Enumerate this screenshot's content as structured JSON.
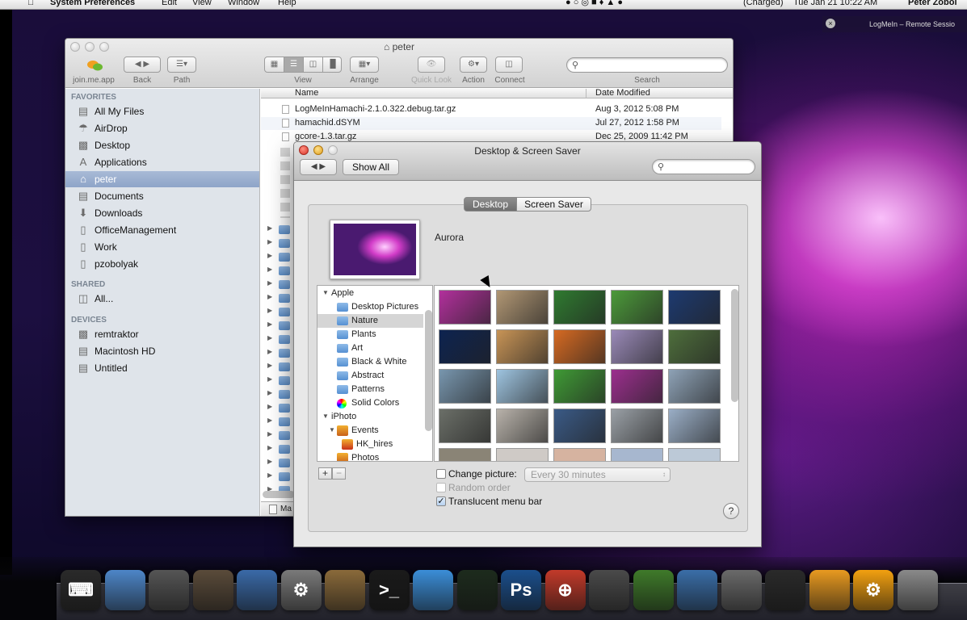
{
  "menubar": {
    "apple": "",
    "app_name": "System Preferences",
    "menus": [
      "Edit",
      "View",
      "Window",
      "Help"
    ],
    "battery_status": "(Charged)",
    "clock": "Tue Jan 21  10:22 AM",
    "user": "Peter Zobol"
  },
  "logmein": {
    "label": "LogMeIn – Remote Sessio"
  },
  "finder": {
    "title": "peter",
    "toolbar": {
      "joinme_label": "join.me.app",
      "back_label": "Back",
      "path_label": "Path",
      "view_label": "View",
      "arrange_label": "Arrange",
      "quicklook_label": "Quick Look",
      "action_label": "Action",
      "connect_label": "Connect",
      "search_label": "Search"
    },
    "sidebar": {
      "favorites_heading": "FAVORITES",
      "favorites": [
        {
          "label": "All My Files",
          "icon": "all-files-icon"
        },
        {
          "label": "AirDrop",
          "icon": "airdrop-icon"
        },
        {
          "label": "Desktop",
          "icon": "desktop-icon"
        },
        {
          "label": "Applications",
          "icon": "applications-icon"
        },
        {
          "label": "peter",
          "icon": "home-icon"
        },
        {
          "label": "Documents",
          "icon": "documents-icon"
        },
        {
          "label": "Downloads",
          "icon": "downloads-icon"
        },
        {
          "label": "OfficeManagement",
          "icon": "folder-icon"
        },
        {
          "label": "Work",
          "icon": "folder-icon"
        },
        {
          "label": "pzobolyak",
          "icon": "folder-icon"
        }
      ],
      "shared_heading": "SHARED",
      "shared": [
        {
          "label": "All...",
          "icon": "network-icon"
        }
      ],
      "devices_heading": "DEVICES",
      "devices": [
        {
          "label": "remtraktor",
          "icon": "computer-icon"
        },
        {
          "label": "Macintosh HD",
          "icon": "hard-drive-icon"
        },
        {
          "label": "Untitled",
          "icon": "disk-icon"
        }
      ]
    },
    "columns": {
      "name": "Name",
      "date_modified": "Date Modified"
    },
    "files": [
      {
        "name": "LogMeInHamachi-2.1.0.322.debug.tar.gz",
        "date": "Aug 3, 2012 5:08 PM"
      },
      {
        "name": "hamachid.dSYM",
        "date": "Jul 27, 2012 1:58 PM"
      },
      {
        "name": "gcore-1.3.tar.gz",
        "date": "Dec 25, 2009 11:42 PM"
      }
    ],
    "status_path": "Ma"
  },
  "prefs": {
    "title": "Desktop & Screen Saver",
    "show_all_label": "Show All",
    "tabs": {
      "desktop": "Desktop",
      "screen_saver": "Screen Saver"
    },
    "current_picture": "Aurora",
    "sources": {
      "apple": "Apple",
      "desktop_pictures": "Desktop Pictures",
      "nature": "Nature",
      "plants": "Plants",
      "art": "Art",
      "black_white": "Black & White",
      "abstract": "Abstract",
      "patterns": "Patterns",
      "solid_colors": "Solid Colors",
      "iphoto": "iPhoto",
      "events": "Events",
      "hk_hires": "HK_hires",
      "photos": "Photos"
    },
    "add_label": "+",
    "remove_label": "−",
    "change_picture_label": "Change picture:",
    "interval_value": "Every 30 minutes",
    "random_order_label": "Random order",
    "translucent_label": "Translucent menu bar",
    "help_label": "?",
    "thumbnails": [
      {
        "name": "aurora",
        "color": "#b2309c"
      },
      {
        "name": "mountains",
        "color": "#b19774"
      },
      {
        "name": "ladybugs",
        "color": "#2f7a30"
      },
      {
        "name": "dew-leaf",
        "color": "#4c9a3a"
      },
      {
        "name": "earth-horizon",
        "color": "#1d3a70"
      },
      {
        "name": "earth-globe",
        "color": "#0d2350"
      },
      {
        "name": "lake-sunset",
        "color": "#c89456"
      },
      {
        "name": "sand-dunes",
        "color": "#d66a22"
      },
      {
        "name": "foggy-waves",
        "color": "#9a8ab8"
      },
      {
        "name": "forest-cliff",
        "color": "#4e6e3c"
      },
      {
        "name": "ocean-horizon",
        "color": "#7896ae"
      },
      {
        "name": "ice-crystals",
        "color": "#9ec4e0"
      },
      {
        "name": "ladybug-leaf",
        "color": "#3f9a35"
      },
      {
        "name": "aurora-2",
        "color": "#9c2f8e"
      },
      {
        "name": "snow-tree",
        "color": "#8ea2b6"
      },
      {
        "name": "zen-stones",
        "color": "#6b6f68"
      },
      {
        "name": "pebbles",
        "color": "#b8b2aa"
      },
      {
        "name": "tiger",
        "color": "#3a5a86"
      },
      {
        "name": "snow-leopard",
        "color": "#9aa0a6"
      },
      {
        "name": "sand-ripples",
        "color": "#9aaec6"
      }
    ]
  },
  "dock": {
    "icons": [
      {
        "name": "keyboard-icon",
        "glyph": "⌨",
        "color": "#2a2a2a"
      },
      {
        "name": "finder-icon",
        "glyph": "",
        "color": "#4d86c8"
      },
      {
        "name": "launchpad-icon",
        "glyph": "",
        "color": "#555"
      },
      {
        "name": "photo-browser-icon",
        "glyph": "",
        "color": "#5a4b3a"
      },
      {
        "name": "network-diagram-icon",
        "glyph": "",
        "color": "#3a6aa8"
      },
      {
        "name": "system-preferences-icon",
        "glyph": "⚙",
        "color": "#7a7a7a"
      },
      {
        "name": "mail-stamp-icon",
        "glyph": "",
        "color": "#8a6a3a"
      },
      {
        "name": "terminal-icon",
        "glyph": ">_",
        "color": "#1a1a1a"
      },
      {
        "name": "safari-icon",
        "glyph": "",
        "color": "#3b8ed8"
      },
      {
        "name": "activity-monitor-icon",
        "glyph": "",
        "color": "#1d2b1d"
      },
      {
        "name": "photoshop-icon",
        "glyph": "Ps",
        "color": "#1b4f8c"
      },
      {
        "name": "chrome-zoom-icon",
        "glyph": "⊕",
        "color": "#c23a2a"
      },
      {
        "name": "facetime-icon",
        "glyph": "",
        "color": "#4a4a4a"
      },
      {
        "name": "hamachi-icon",
        "glyph": "",
        "color": "#3f7a2a"
      },
      {
        "name": "xcode-icon",
        "glyph": "",
        "color": "#3a6ea8"
      },
      {
        "name": "preview-icon",
        "glyph": "",
        "color": "#6a6a6a"
      },
      {
        "name": "console-icon",
        "glyph": "",
        "color": "#2a2a2a"
      },
      {
        "name": "joinme-icon",
        "glyph": "",
        "color": "#e89a20"
      },
      {
        "name": "settings-gear-icon",
        "glyph": "⚙",
        "color": "#f2a010"
      },
      {
        "name": "trash-icon",
        "glyph": "",
        "color": "#8a8a8a"
      }
    ]
  }
}
